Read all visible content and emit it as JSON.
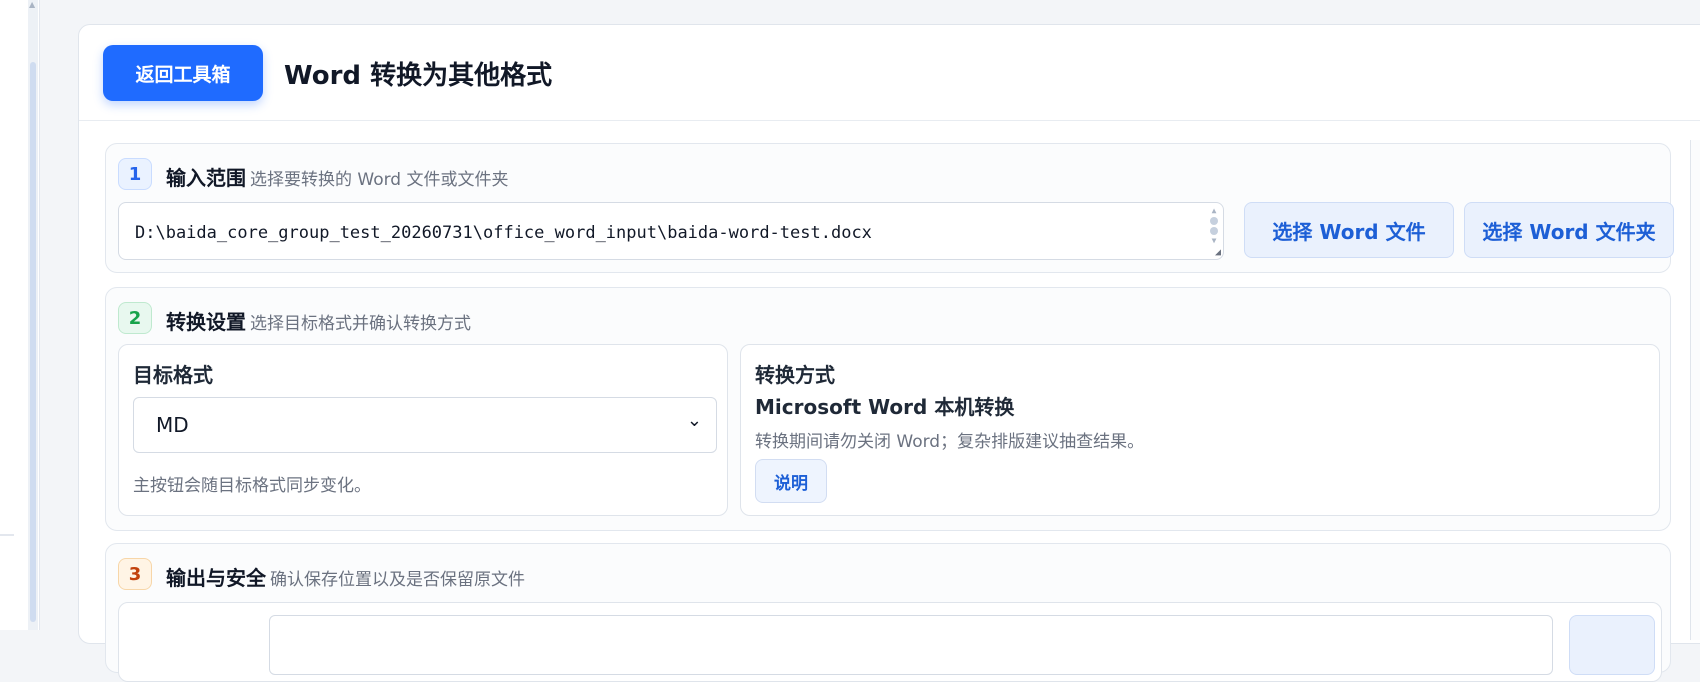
{
  "header": {
    "back_label": "返回工具箱",
    "title": "Word 转换为其他格式"
  },
  "sections": {
    "input": {
      "step": "1",
      "title": "输入范围",
      "subtitle": "选择要转换的 Word 文件或文件夹",
      "path_value": "D:\\baida_core_group_test_20260731\\office_word_input\\baida-word-test.docx",
      "select_file_label": "选择 Word 文件",
      "select_folder_label": "选择 Word 文件夹"
    },
    "settings": {
      "step": "2",
      "title": "转换设置",
      "subtitle": "选择目标格式并确认转换方式",
      "target_label": "目标格式",
      "target_value": "MD",
      "target_hint": "主按钮会随目标格式同步变化。",
      "method_label": "转换方式",
      "method_name": "Microsoft Word 本机转换",
      "method_desc": "转换期间请勿关闭 Word；复杂排版建议抽查结果。",
      "explain_label": "说明"
    },
    "output": {
      "step": "3",
      "title": "输出与安全",
      "subtitle": "确认保存位置以及是否保留原文件"
    }
  },
  "colors": {
    "accent": "#1f6bff",
    "step1": "#2563eb",
    "step2": "#16a34a",
    "step3": "#c2410c"
  }
}
